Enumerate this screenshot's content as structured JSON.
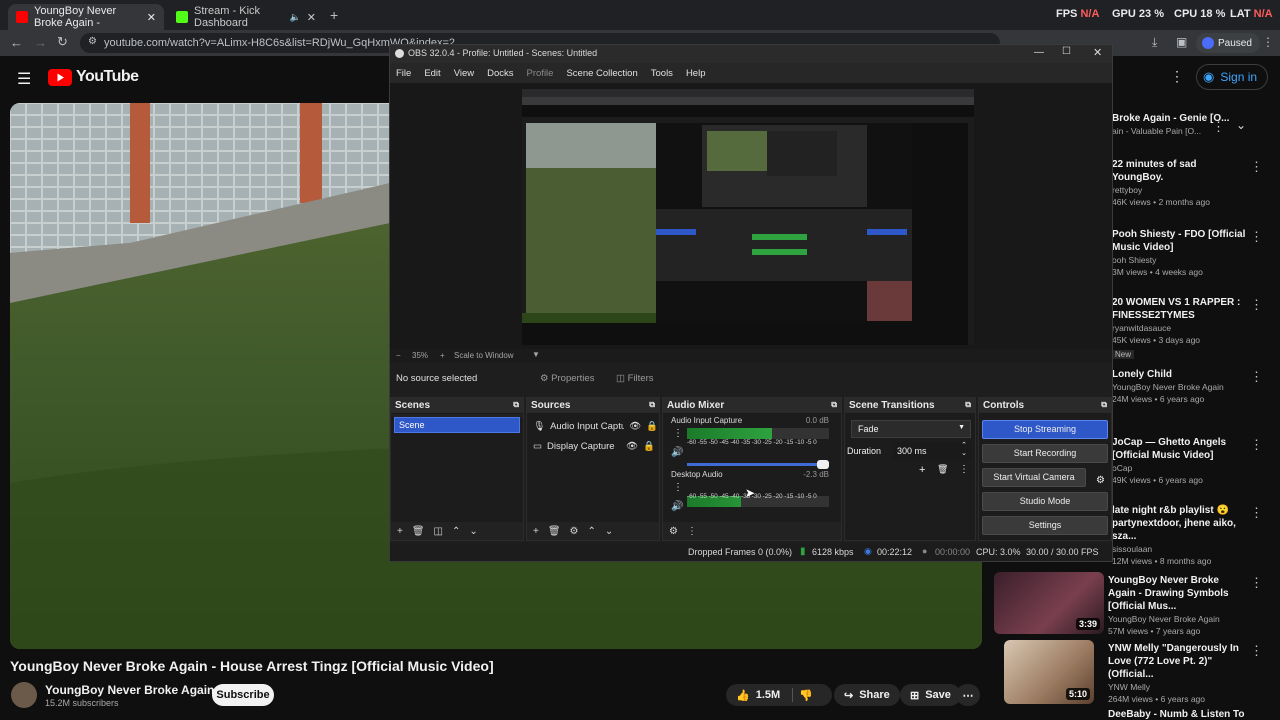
{
  "browser": {
    "tabs": [
      {
        "title": "YoungBoy Never Broke Again -",
        "active": true
      },
      {
        "title": "Stream - Kick Dashboard",
        "active": false
      }
    ],
    "url": "youtube.com/watch?v=ALimx-H8C6s&list=RDjWu_GqHxmWQ&index=2",
    "paused": "Paused",
    "perf": {
      "fps_label": "FPS",
      "fps_value": "N/A",
      "gpu_label": "GPU",
      "gpu_value": "23 %",
      "cpu_label": "CPU",
      "cpu_value": "18 %",
      "lat_label": "LAT",
      "lat_value": "N/A"
    }
  },
  "youtube": {
    "logo": "YouTube",
    "sign_in": "Sign in",
    "video_title": "YoungBoy Never Broke Again - House Arrest Tingz [Official Music Video]",
    "channel": "YoungBoy Never Broke Again",
    "subscribers": "15.2M subscribers",
    "subscribe": "Subscribe",
    "likes": "1.5M",
    "share": "Share",
    "save": "Save"
  },
  "sidebar": {
    "items": [
      {
        "title": "Broke Again - Genie [O...",
        "meta1": "ain - Valuable Pain [O...",
        "meta2": ""
      },
      {
        "title": "22 minutes of sad YoungBoy.",
        "meta1": "rettyboy",
        "meta2": "46K views • 2 months ago"
      },
      {
        "title": "Pooh Shiesty - FDO [Official Music Video]",
        "meta1": "ooh Shiesty",
        "meta2": "3M views • 4 weeks ago"
      },
      {
        "title": "20 WOMEN VS 1 RAPPER : FINESSE2TYMES",
        "meta1": "ryanwitdasauce",
        "meta2": "45K views • 3 days ago",
        "badge": "New"
      },
      {
        "title": "Lonely Child",
        "meta1": "YoungBoy Never Broke Again",
        "meta2": "24M views • 6 years ago"
      },
      {
        "title": "JoCap — Ghetto Angels [Official Music Video]",
        "meta1": "oCap",
        "meta2": "49K views • 6 years ago"
      },
      {
        "title": "late night r&b playlist 😮 partynextdoor, jhene aiko, sza...",
        "meta1": "sissoulaan",
        "meta2": "12M views • 8 months ago"
      },
      {
        "title": "YoungBoy Never Broke Again - Drawing Symbols [Official Mus...",
        "meta1": "YoungBoy Never Broke Again",
        "meta2": "57M views • 7 years ago",
        "duration": "3:39"
      },
      {
        "title": "YNW Melly \"Dangerously In Love (772 Love Pt. 2)\" (Official...",
        "meta1": "YNW Melly",
        "meta2": "264M views • 6 years ago",
        "duration": "5:10"
      },
      {
        "title": "DeeBaby - Numb & Listen To",
        "meta1": "",
        "meta2": ""
      }
    ]
  },
  "obs": {
    "title": "OBS 32.0.4 - Profile: Untitled - Scenes: Untitled",
    "menu": [
      "File",
      "Edit",
      "View",
      "Docks",
      "Profile",
      "Scene Collection",
      "Tools",
      "Help"
    ],
    "zoom": "35%",
    "scale_label": "Scale to Window",
    "no_source": "No source selected",
    "properties": "Properties",
    "filters": "Filters",
    "docks": {
      "scenes": "Scenes",
      "sources": "Sources",
      "audio_mixer": "Audio Mixer",
      "scene_transitions": "Scene Transitions",
      "controls": "Controls"
    },
    "scene_list": [
      "Scene"
    ],
    "source_list": [
      "Audio Input Captu",
      "Display Capture"
    ],
    "mixer": [
      {
        "name": "Audio Input Capture",
        "db": "0.0 dB",
        "level": 0.6,
        "volume": 1.0
      },
      {
        "name": "Desktop Audio",
        "db": "-2.3 dB",
        "level": 0.38,
        "volume": 0.78
      }
    ],
    "meter_ticks": "-60 -55 -50 -45 -40 -35 -30 -25 -20 -15 -10  -5  0",
    "transition": "Fade",
    "duration_label": "Duration",
    "duration_value": "300 ms",
    "controls": [
      "Stop Streaming",
      "Start Recording",
      "Start Virtual Camera",
      "Studio Mode",
      "Settings"
    ],
    "status": {
      "dropped": "Dropped Frames 0 (0.0%)",
      "kbps": "6128 kbps",
      "stream_time": "00:22:12",
      "rec_time": "00:00:00",
      "cpu": "CPU: 3.0%",
      "fps": "30.00 / 30.00 FPS"
    }
  }
}
